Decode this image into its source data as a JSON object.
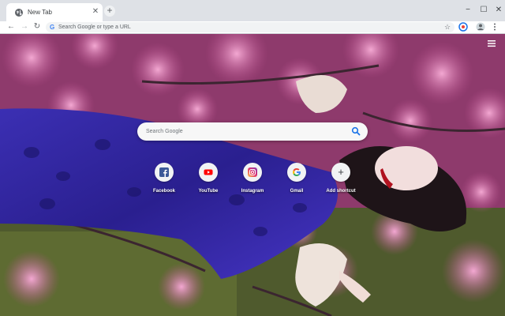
{
  "tab": {
    "title": "New Tab",
    "close_glyph": "✕",
    "icon": "globe-icon"
  },
  "newtab_glyph": "+",
  "window": {
    "minimize": "−",
    "maximize": "☐",
    "close": "✕"
  },
  "nav": {
    "back": "←",
    "forward": "→",
    "reload": "↻"
  },
  "omnibox": {
    "placeholder": "Search Google or type a URL",
    "g": "G",
    "star": "☆"
  },
  "search": {
    "placeholder": "Search Google"
  },
  "shortcuts": [
    {
      "label": "Facebook",
      "icon": "facebook-icon"
    },
    {
      "label": "YouTube",
      "icon": "youtube-icon"
    },
    {
      "label": "Instagram",
      "icon": "instagram-icon"
    },
    {
      "label": "Gmail",
      "icon": "google-icon"
    },
    {
      "label": "Add shortcut",
      "icon": "plus-icon",
      "glyph": "+"
    }
  ],
  "colors": {
    "tabstrip": "#dee1e6",
    "accent": "#1a73e8",
    "bg_flower": "#d76fae"
  }
}
